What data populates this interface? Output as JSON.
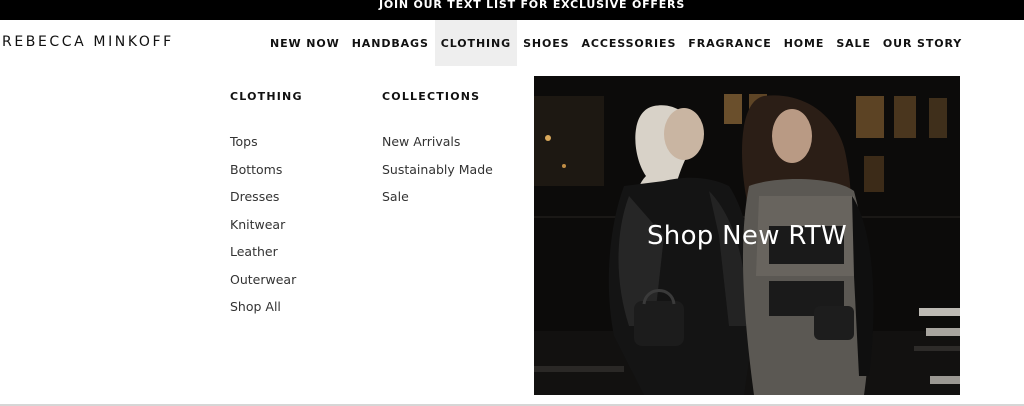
{
  "promo_bar": {
    "text": "JOIN OUR TEXT LIST FOR EXCLUSIVE OFFERS"
  },
  "brand": {
    "logo_text": "REBECCA MINKOFF"
  },
  "nav": {
    "items": [
      {
        "label": "NEW NOW",
        "active": false
      },
      {
        "label": "HANDBAGS",
        "active": false
      },
      {
        "label": "CLOTHING",
        "active": true
      },
      {
        "label": "SHOES",
        "active": false
      },
      {
        "label": "ACCESSORIES",
        "active": false
      },
      {
        "label": "FRAGRANCE",
        "active": false
      },
      {
        "label": "HOME",
        "active": false
      },
      {
        "label": "SALE",
        "active": false
      },
      {
        "label": "OUR STORY",
        "active": false
      }
    ]
  },
  "mega_menu": {
    "clothing": {
      "heading": "CLOTHING",
      "links": [
        "Tops",
        "Bottoms",
        "Dresses",
        "Knitwear",
        "Leather",
        "Outerwear",
        "Shop All"
      ]
    },
    "collections": {
      "heading": "COLLECTIONS",
      "links": [
        "New Arrivals",
        "Sustainably Made",
        "Sale"
      ]
    },
    "promo": {
      "caption": "Shop New RTW"
    }
  },
  "colors": {
    "promo_bar_bg": "#000000",
    "active_nav_bg": "#eeeeee",
    "text": "#111111"
  }
}
